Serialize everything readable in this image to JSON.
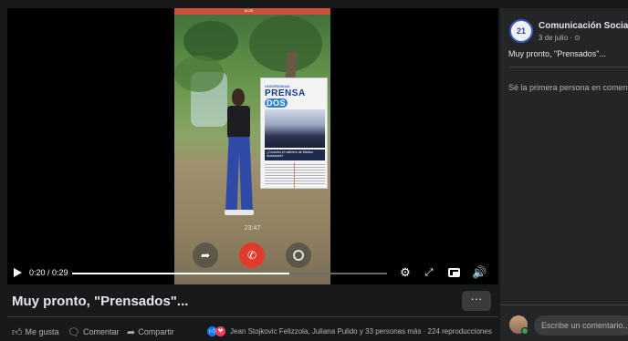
{
  "video": {
    "status_left": "",
    "status_time": "16:25",
    "brochure_header": "UNIVERSIDAD",
    "brochure_title_a": "PRENSA",
    "brochure_title_b": "DOS",
    "brochure_caption": "¿Conoces el noticiero de Medios Andaluces?",
    "call_duration": "23:47",
    "time": "0:20 / 0:29",
    "progress_fraction": 0.69
  },
  "post": {
    "title": "Muy pronto, \"Prensados\"...",
    "more_label": "···",
    "like_label": "Me gusta",
    "comment_label": "Comentar",
    "share_label": "Compartir",
    "reactions_text": "Jean Stojkovic Felizzola, Juliana Pulido y 33 personas más · 224 reproducciones"
  },
  "sidebar": {
    "page_name": "Comunicación Social",
    "avatar_text": "21",
    "date": "3 de julio · ⊙",
    "description": "Muy pronto, \"Prensados\"...",
    "first_comment_prompt": "Sé la primera persona en comentar",
    "comment_placeholder": "Escribe un comentario..."
  },
  "icons": {
    "play": "play-icon",
    "settings": "gear-icon",
    "fullscreen": "expand-icon",
    "pip": "picture-in-picture-icon",
    "volume": "volume-icon",
    "like": "thumbs-up-icon",
    "comment": "comment-icon",
    "share": "share-icon"
  },
  "colors": {
    "background": "#18191a",
    "panel": "#242526",
    "accent": "#1877f2",
    "hangup": "#e23b2e"
  }
}
